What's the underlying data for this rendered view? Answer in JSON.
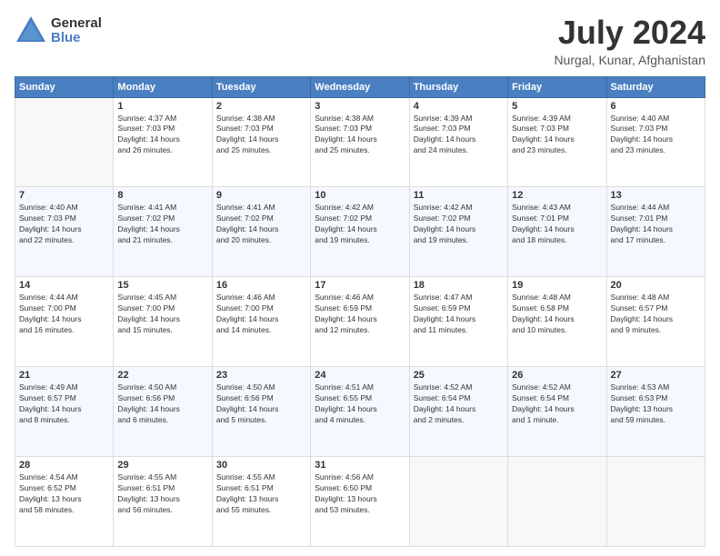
{
  "header": {
    "logo_general": "General",
    "logo_blue": "Blue",
    "month_title": "July 2024",
    "location": "Nurgal, Kunar, Afghanistan"
  },
  "weekdays": [
    "Sunday",
    "Monday",
    "Tuesday",
    "Wednesday",
    "Thursday",
    "Friday",
    "Saturday"
  ],
  "weeks": [
    [
      {
        "day": "",
        "sunrise": "",
        "sunset": "",
        "daylight": ""
      },
      {
        "day": "1",
        "sunrise": "Sunrise: 4:37 AM",
        "sunset": "Sunset: 7:03 PM",
        "daylight": "Daylight: 14 hours and 26 minutes."
      },
      {
        "day": "2",
        "sunrise": "Sunrise: 4:38 AM",
        "sunset": "Sunset: 7:03 PM",
        "daylight": "Daylight: 14 hours and 25 minutes."
      },
      {
        "day": "3",
        "sunrise": "Sunrise: 4:38 AM",
        "sunset": "Sunset: 7:03 PM",
        "daylight": "Daylight: 14 hours and 25 minutes."
      },
      {
        "day": "4",
        "sunrise": "Sunrise: 4:39 AM",
        "sunset": "Sunset: 7:03 PM",
        "daylight": "Daylight: 14 hours and 24 minutes."
      },
      {
        "day": "5",
        "sunrise": "Sunrise: 4:39 AM",
        "sunset": "Sunset: 7:03 PM",
        "daylight": "Daylight: 14 hours and 23 minutes."
      },
      {
        "day": "6",
        "sunrise": "Sunrise: 4:40 AM",
        "sunset": "Sunset: 7:03 PM",
        "daylight": "Daylight: 14 hours and 23 minutes."
      }
    ],
    [
      {
        "day": "7",
        "sunrise": "Sunrise: 4:40 AM",
        "sunset": "Sunset: 7:03 PM",
        "daylight": "Daylight: 14 hours and 22 minutes."
      },
      {
        "day": "8",
        "sunrise": "Sunrise: 4:41 AM",
        "sunset": "Sunset: 7:02 PM",
        "daylight": "Daylight: 14 hours and 21 minutes."
      },
      {
        "day": "9",
        "sunrise": "Sunrise: 4:41 AM",
        "sunset": "Sunset: 7:02 PM",
        "daylight": "Daylight: 14 hours and 20 minutes."
      },
      {
        "day": "10",
        "sunrise": "Sunrise: 4:42 AM",
        "sunset": "Sunset: 7:02 PM",
        "daylight": "Daylight: 14 hours and 19 minutes."
      },
      {
        "day": "11",
        "sunrise": "Sunrise: 4:42 AM",
        "sunset": "Sunset: 7:02 PM",
        "daylight": "Daylight: 14 hours and 19 minutes."
      },
      {
        "day": "12",
        "sunrise": "Sunrise: 4:43 AM",
        "sunset": "Sunset: 7:01 PM",
        "daylight": "Daylight: 14 hours and 18 minutes."
      },
      {
        "day": "13",
        "sunrise": "Sunrise: 4:44 AM",
        "sunset": "Sunset: 7:01 PM",
        "daylight": "Daylight: 14 hours and 17 minutes."
      }
    ],
    [
      {
        "day": "14",
        "sunrise": "Sunrise: 4:44 AM",
        "sunset": "Sunset: 7:00 PM",
        "daylight": "Daylight: 14 hours and 16 minutes."
      },
      {
        "day": "15",
        "sunrise": "Sunrise: 4:45 AM",
        "sunset": "Sunset: 7:00 PM",
        "daylight": "Daylight: 14 hours and 15 minutes."
      },
      {
        "day": "16",
        "sunrise": "Sunrise: 4:46 AM",
        "sunset": "Sunset: 7:00 PM",
        "daylight": "Daylight: 14 hours and 14 minutes."
      },
      {
        "day": "17",
        "sunrise": "Sunrise: 4:46 AM",
        "sunset": "Sunset: 6:59 PM",
        "daylight": "Daylight: 14 hours and 12 minutes."
      },
      {
        "day": "18",
        "sunrise": "Sunrise: 4:47 AM",
        "sunset": "Sunset: 6:59 PM",
        "daylight": "Daylight: 14 hours and 11 minutes."
      },
      {
        "day": "19",
        "sunrise": "Sunrise: 4:48 AM",
        "sunset": "Sunset: 6:58 PM",
        "daylight": "Daylight: 14 hours and 10 minutes."
      },
      {
        "day": "20",
        "sunrise": "Sunrise: 4:48 AM",
        "sunset": "Sunset: 6:57 PM",
        "daylight": "Daylight: 14 hours and 9 minutes."
      }
    ],
    [
      {
        "day": "21",
        "sunrise": "Sunrise: 4:49 AM",
        "sunset": "Sunset: 6:57 PM",
        "daylight": "Daylight: 14 hours and 8 minutes."
      },
      {
        "day": "22",
        "sunrise": "Sunrise: 4:50 AM",
        "sunset": "Sunset: 6:56 PM",
        "daylight": "Daylight: 14 hours and 6 minutes."
      },
      {
        "day": "23",
        "sunrise": "Sunrise: 4:50 AM",
        "sunset": "Sunset: 6:56 PM",
        "daylight": "Daylight: 14 hours and 5 minutes."
      },
      {
        "day": "24",
        "sunrise": "Sunrise: 4:51 AM",
        "sunset": "Sunset: 6:55 PM",
        "daylight": "Daylight: 14 hours and 4 minutes."
      },
      {
        "day": "25",
        "sunrise": "Sunrise: 4:52 AM",
        "sunset": "Sunset: 6:54 PM",
        "daylight": "Daylight: 14 hours and 2 minutes."
      },
      {
        "day": "26",
        "sunrise": "Sunrise: 4:52 AM",
        "sunset": "Sunset: 6:54 PM",
        "daylight": "Daylight: 14 hours and 1 minute."
      },
      {
        "day": "27",
        "sunrise": "Sunrise: 4:53 AM",
        "sunset": "Sunset: 6:53 PM",
        "daylight": "Daylight: 13 hours and 59 minutes."
      }
    ],
    [
      {
        "day": "28",
        "sunrise": "Sunrise: 4:54 AM",
        "sunset": "Sunset: 6:52 PM",
        "daylight": "Daylight: 13 hours and 58 minutes."
      },
      {
        "day": "29",
        "sunrise": "Sunrise: 4:55 AM",
        "sunset": "Sunset: 6:51 PM",
        "daylight": "Daylight: 13 hours and 56 minutes."
      },
      {
        "day": "30",
        "sunrise": "Sunrise: 4:55 AM",
        "sunset": "Sunset: 6:51 PM",
        "daylight": "Daylight: 13 hours and 55 minutes."
      },
      {
        "day": "31",
        "sunrise": "Sunrise: 4:56 AM",
        "sunset": "Sunset: 6:50 PM",
        "daylight": "Daylight: 13 hours and 53 minutes."
      },
      {
        "day": "",
        "sunrise": "",
        "sunset": "",
        "daylight": ""
      },
      {
        "day": "",
        "sunrise": "",
        "sunset": "",
        "daylight": ""
      },
      {
        "day": "",
        "sunrise": "",
        "sunset": "",
        "daylight": ""
      }
    ]
  ]
}
